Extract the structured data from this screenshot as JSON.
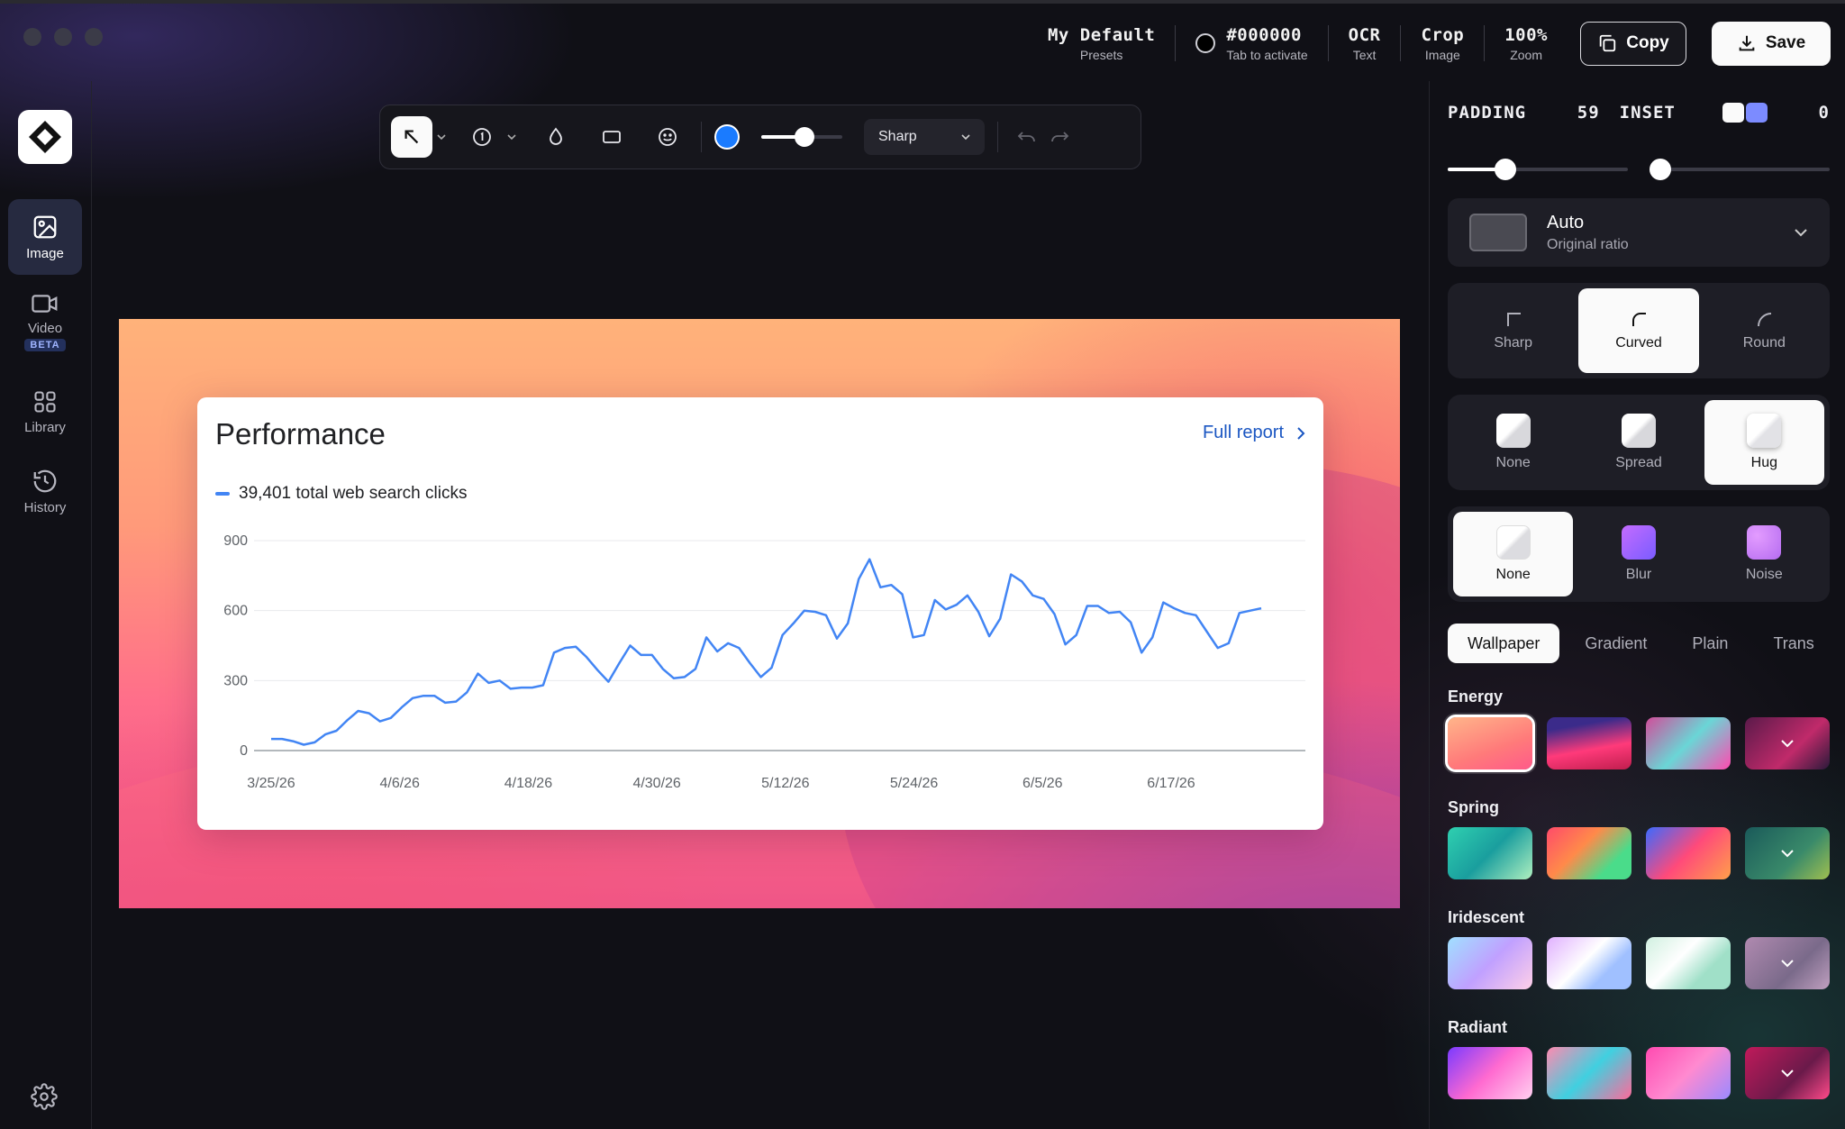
{
  "topbar": {
    "preset_value": "My Default",
    "preset_label": "Presets",
    "color_value": "#000000",
    "color_label": "Tab to activate",
    "ocr_value": "OCR",
    "ocr_label": "Text",
    "crop_value": "Crop",
    "crop_label": "Image",
    "zoom_value": "100%",
    "zoom_label": "Zoom",
    "copy_label": "Copy",
    "save_label": "Save"
  },
  "sidebar": {
    "items": [
      {
        "label": "Image",
        "icon": "image-icon",
        "active": true
      },
      {
        "label": "Video",
        "icon": "video-icon",
        "badge": "BETA"
      },
      {
        "label": "Library",
        "icon": "library-icon"
      },
      {
        "label": "History",
        "icon": "history-icon"
      }
    ]
  },
  "annotation": {
    "tools": [
      "arrow-icon",
      "counter-icon",
      "blur-drop-icon",
      "rectangle-icon",
      "emoji-icon"
    ],
    "color": "#1a7bff",
    "stroke_level": 0.53,
    "style_value": "Sharp"
  },
  "card": {
    "title": "Performance",
    "full_report": "Full report",
    "legend": "39,401 total web search clicks"
  },
  "chart_data": {
    "type": "line",
    "ylim": [
      0,
      900
    ],
    "yticks": [
      "900",
      "600",
      "300",
      "0"
    ],
    "xticks": [
      "3/25/26",
      "4/6/26",
      "4/18/26",
      "4/30/26",
      "5/12/26",
      "5/24/26",
      "6/5/26",
      "6/17/26"
    ],
    "color": "#4285f4",
    "values": [
      50,
      50,
      40,
      25,
      35,
      70,
      85,
      130,
      170,
      160,
      125,
      140,
      185,
      225,
      235,
      235,
      205,
      210,
      250,
      330,
      290,
      300,
      265,
      270,
      270,
      280,
      420,
      440,
      445,
      400,
      345,
      295,
      375,
      450,
      410,
      410,
      350,
      310,
      315,
      350,
      485,
      425,
      460,
      440,
      375,
      315,
      355,
      495,
      545,
      600,
      595,
      580,
      480,
      545,
      735,
      820,
      700,
      710,
      670,
      485,
      495,
      645,
      605,
      625,
      665,
      595,
      490,
      565,
      755,
      725,
      665,
      650,
      585,
      455,
      495,
      620,
      620,
      590,
      595,
      550,
      420,
      485,
      635,
      610,
      590,
      580,
      510,
      440,
      460,
      590,
      600,
      610
    ]
  },
  "right_panel": {
    "padding_label": "PADDING",
    "padding_value": "59",
    "padding_level": 0.32,
    "inset_label": "INSET",
    "inset_value": "0",
    "inset_level": 0.0,
    "ratio_title": "Auto",
    "ratio_sub": "Original ratio",
    "corners": [
      "Sharp",
      "Curved",
      "Round"
    ],
    "shadows": [
      "None",
      "Spread",
      "Hug"
    ],
    "effects": [
      "None",
      "Blur",
      "Noise"
    ],
    "bg_tabs": [
      "Wallpaper",
      "Gradient",
      "Plain",
      "Trans"
    ],
    "categories": [
      {
        "name": "Energy"
      },
      {
        "name": "Spring"
      },
      {
        "name": "Iridescent"
      },
      {
        "name": "Radiant"
      }
    ]
  }
}
